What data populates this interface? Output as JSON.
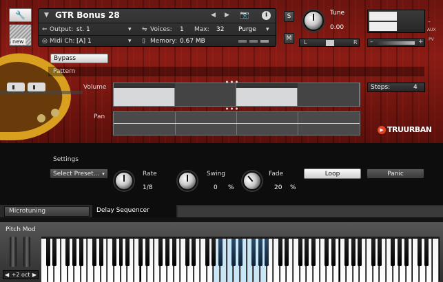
{
  "header": {
    "instrument_name": "GTR Bonus 28",
    "output_label": "Output:",
    "output_value": "st. 1",
    "voices_label": "Voices:",
    "voices_value": "1",
    "max_label": "Max:",
    "max_value": "32",
    "purge_label": "Purge",
    "midi_label": "Midi Ch:",
    "midi_value": "[A]  1",
    "memory_label": "Memory:",
    "memory_value": "0.67 MB",
    "new_label": "new",
    "solo": "S",
    "mute": "M",
    "tune_label": "Tune",
    "tune_value": "0.00",
    "pan_l": "L",
    "pan_r": "R",
    "aux_label": "AUX",
    "pv_label": "PV"
  },
  "sequencer": {
    "bypass_label": "Bypass",
    "pattern_label": "Pattern",
    "volume_label": "Volume",
    "pan_label": "Pan",
    "steps_label": "Steps:",
    "steps_value": "4",
    "brand": "TRUURBAN",
    "volume_steps": [
      0.78,
      0.0,
      0.78,
      0.0
    ]
  },
  "settings": {
    "title": "Settings",
    "preset_label": "Select Preset...",
    "rate_label": "Rate",
    "rate_value": "1/8",
    "swing_label": "Swing",
    "swing_value": "0",
    "swing_unit": "%",
    "fade_label": "Fade",
    "fade_value": "20",
    "fade_unit": "%",
    "loop_label": "Loop",
    "panic_label": "Panic"
  },
  "tabs": {
    "microtuning": "Microtuning",
    "delay_sequencer": "Delay Sequencer"
  },
  "keyboard": {
    "pitch_mod_label": "Pitch Mod",
    "octave_label": "+2 oct"
  }
}
